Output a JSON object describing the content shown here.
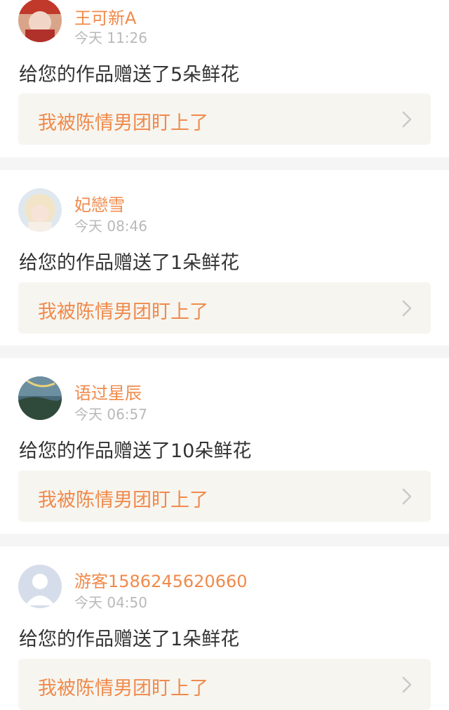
{
  "notifications": [
    {
      "username": "王可新A",
      "time": "今天 11:26",
      "message": "给您的作品赠送了5朵鲜花",
      "link": "我被陈情男团盯上了",
      "avatar": "avatar-bride"
    },
    {
      "username": "妃戀雪",
      "time": "今天 08:46",
      "message": "给您的作品赠送了1朵鲜花",
      "link": "我被陈情男团盯上了",
      "avatar": "avatar-anime-girl"
    },
    {
      "username": "语过星辰",
      "time": "今天 06:57",
      "message": "给您的作品赠送了10朵鲜花",
      "link": "我被陈情男团盯上了",
      "avatar": "avatar-landscape"
    },
    {
      "username": "游客1586245620660",
      "time": "今天 04:50",
      "message": "给您的作品赠送了1朵鲜花",
      "link": "我被陈情男团盯上了",
      "avatar": "avatar-default"
    }
  ],
  "colors": {
    "accent": "#f08a4b",
    "separator": "#f5f5f5",
    "link_bg": "#f6f5f0"
  }
}
